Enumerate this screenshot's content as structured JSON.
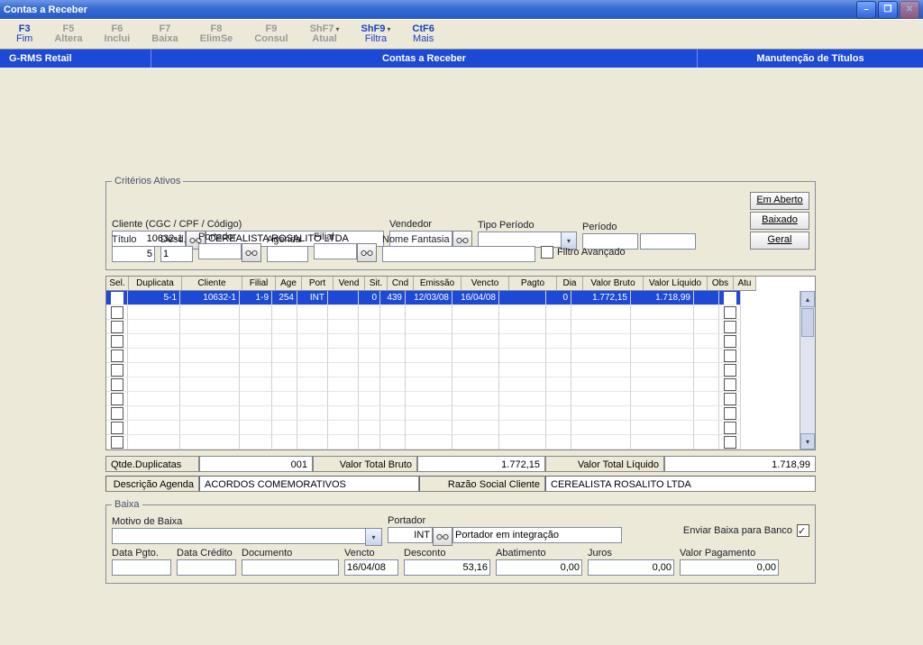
{
  "window": {
    "title": "Contas a Receber"
  },
  "toolbar": [
    {
      "key": "F3",
      "label": "Fim",
      "active": true,
      "drop": false
    },
    {
      "key": "F5",
      "label": "Altera",
      "active": false,
      "drop": false
    },
    {
      "key": "F6",
      "label": "Inclui",
      "active": false,
      "drop": false
    },
    {
      "key": "F7",
      "label": "Baixa",
      "active": false,
      "drop": false
    },
    {
      "key": "F8",
      "label": "ElimSe",
      "active": false,
      "drop": false
    },
    {
      "key": "F9",
      "label": "Consul",
      "active": false,
      "drop": false
    },
    {
      "key": "ShF7",
      "label": "Atual",
      "active": false,
      "drop": true
    },
    {
      "key": "ShF9",
      "label": "Filtra",
      "active": true,
      "drop": true
    },
    {
      "key": "CtF6",
      "label": "Mais",
      "active": true,
      "drop": false
    }
  ],
  "blueband": {
    "left": "G-RMS Retail",
    "center": "Contas a Receber",
    "right": "Manutenção de Títulos"
  },
  "criterios": {
    "title": "Critérios Ativos",
    "cliente_label": "Cliente (CGC / CPF / Código)",
    "cliente_code": "10632-1",
    "cliente_nome": "CEREALISTA ROSALITO LTDA",
    "vendedor_label": "Vendedor",
    "tipo_periodo_label": "Tipo Período",
    "periodo_label": "Período",
    "titulo_label": "Título",
    "titulo": "5",
    "desd_label": "Desd.",
    "desd": "1",
    "portador_label": "Portador",
    "agenda_label": "Agenda",
    "filial_label": "Filial",
    "nome_fantasia_label": "Nome Fantasia",
    "filtro_avancado_label": "Filtro Avançado"
  },
  "statebtns": {
    "aberto": "Em Aberto",
    "baixado": "Baixado",
    "geral": "Geral"
  },
  "grid": {
    "headers": [
      "Sel.",
      "Duplicata",
      "Cliente",
      "Filial",
      "Age",
      "Port",
      "Vend",
      "Sit.",
      "Cnd",
      "Emissão",
      "Vencto",
      "Pagto",
      "Dia",
      "Valor Bruto",
      "Valor Líquido",
      "Obs",
      "Atu"
    ],
    "widths": [
      24,
      58,
      66,
      36,
      28,
      34,
      34,
      24,
      28,
      52,
      52,
      52,
      28,
      66,
      70,
      28,
      24
    ],
    "row": {
      "dup": "5-1",
      "cli": "10632-1",
      "fil": "1-9",
      "age": "254",
      "port": "INT",
      "vend": "",
      "sit": "0",
      "cnd": "439",
      "emi": "12/03/08",
      "ven": "16/04/08",
      "pag": "",
      "dia": "0",
      "vb": "1.772,15",
      "vl": "1.718,99"
    }
  },
  "summary": {
    "qtde_label": "Qtde.Duplicatas",
    "qtde": "001",
    "vb_label": "Valor Total Bruto",
    "vb": "1.772,15",
    "vl_label": "Valor Total Líquido",
    "vl": "1.718,99"
  },
  "desc": {
    "agenda_label": "Descrição Agenda",
    "agenda": "ACORDOS COMEMORATIVOS",
    "razao_label": "Razão Social Cliente",
    "razao": "CEREALISTA ROSALITO LTDA"
  },
  "baixa": {
    "title": "Baixa",
    "motivo_label": "Motivo de Baixa",
    "portador_label": "Portador",
    "portador": "INT",
    "portador_desc": "Portador em integração",
    "enviar_label": "Enviar Baixa para Banco",
    "data_pgto_label": "Data Pgto.",
    "data_credito_label": "Data Crédito",
    "documento_label": "Documento",
    "vencto_label": "Vencto",
    "vencto": "16/04/08",
    "desconto_label": "Desconto",
    "desconto": "53,16",
    "abatimento_label": "Abatimento",
    "abatimento": "0,00",
    "juros_label": "Juros",
    "juros": "0,00",
    "valor_pag_label": "Valor Pagamento",
    "valor_pag": "0,00"
  }
}
